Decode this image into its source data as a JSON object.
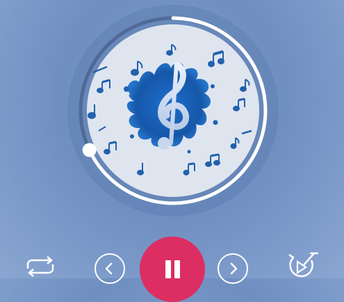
{
  "player": {
    "progress": 0.68,
    "disc_badge": "",
    "colors": {
      "accent": "#dc2e63",
      "ring": "#ffffff",
      "disc": "#dfe5ef",
      "splash": "#1e63b4"
    }
  },
  "controls": {
    "repeat_icon": "repeat-icon",
    "prev_icon": "previous-icon",
    "play_icon": "pause-icon",
    "next_icon": "next-icon",
    "shuffle_icon": "shuffle-timer-icon"
  }
}
